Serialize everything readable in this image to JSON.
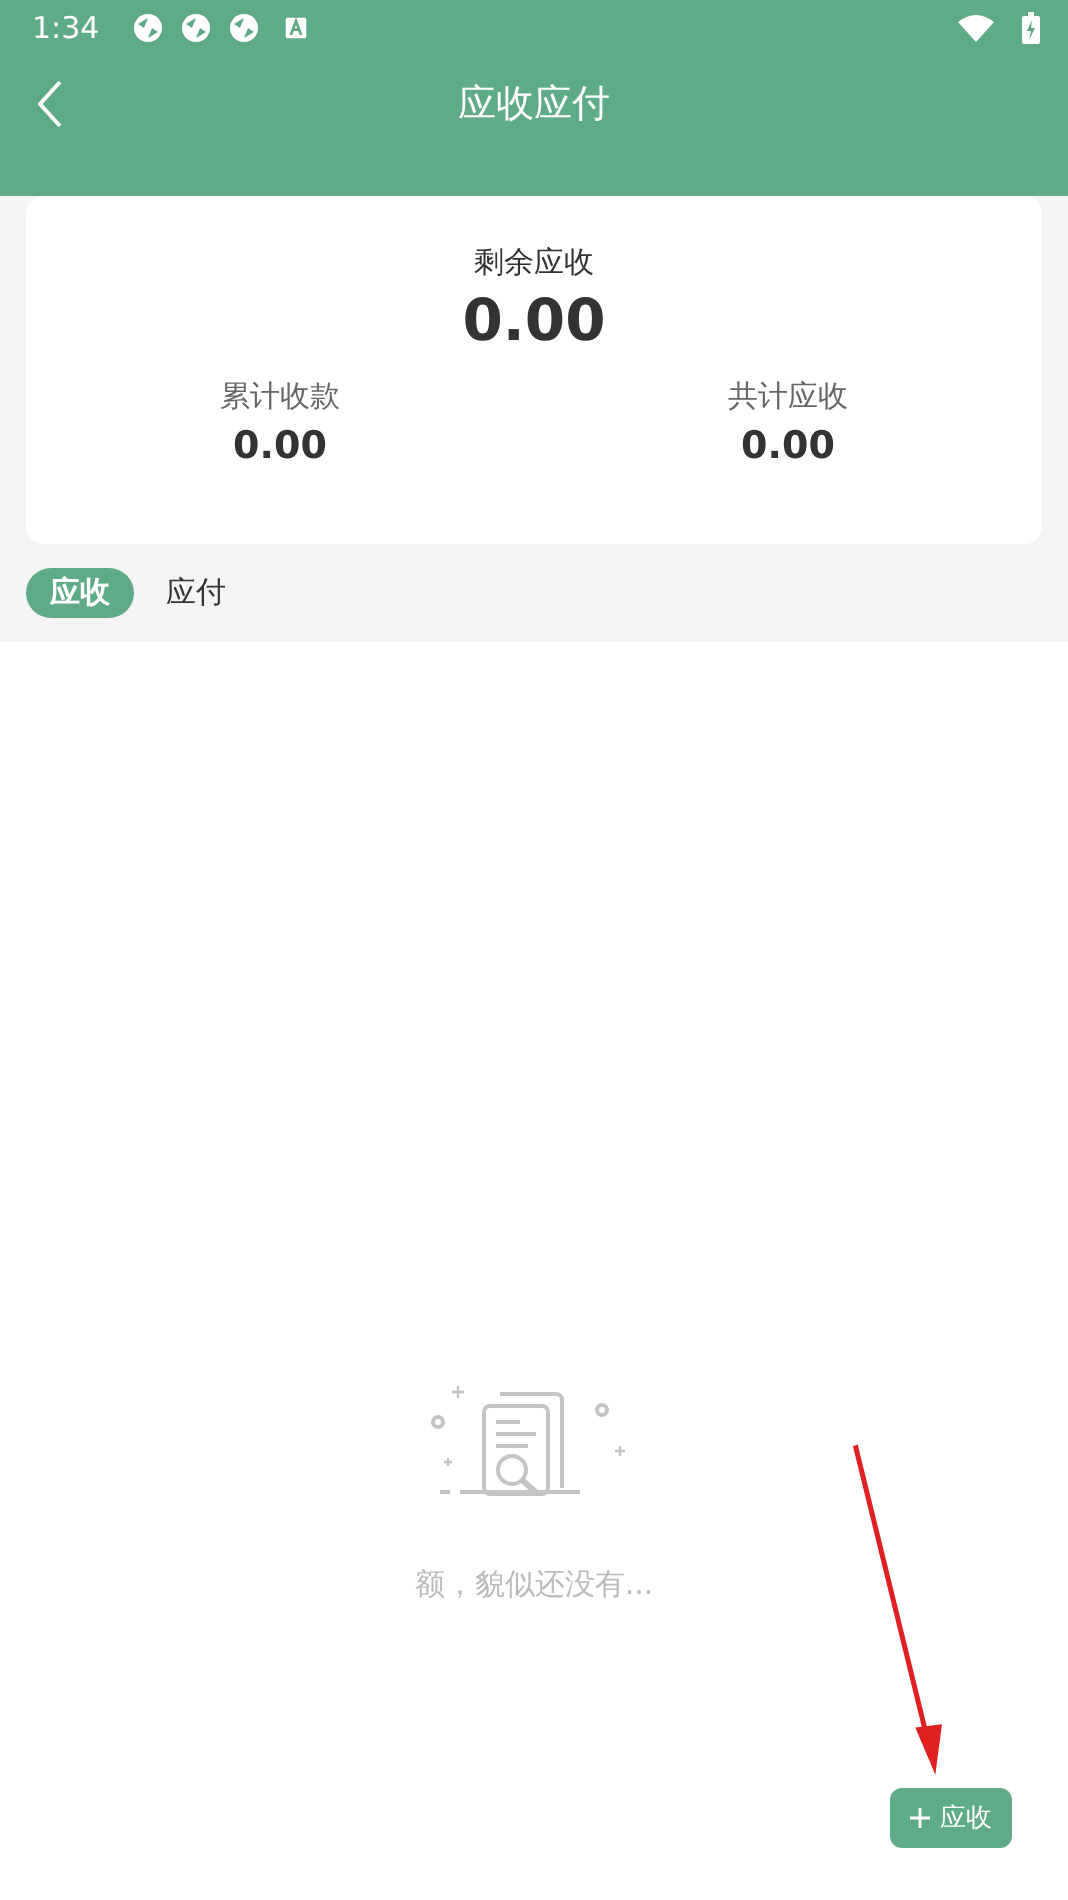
{
  "status_bar": {
    "time": "1:34"
  },
  "header": {
    "title": "应收应付"
  },
  "summary": {
    "main_label": "剩余应收",
    "main_value": "0.00",
    "stats": [
      {
        "label": "累计收款",
        "value": "0.00"
      },
      {
        "label": "共计应收",
        "value": "0.00"
      }
    ]
  },
  "tabs": [
    {
      "label": "应收",
      "selected": true
    },
    {
      "label": "应付",
      "selected": false
    }
  ],
  "empty_state": {
    "message": "额，貌似还没有..."
  },
  "add_button": {
    "label": "应收"
  }
}
